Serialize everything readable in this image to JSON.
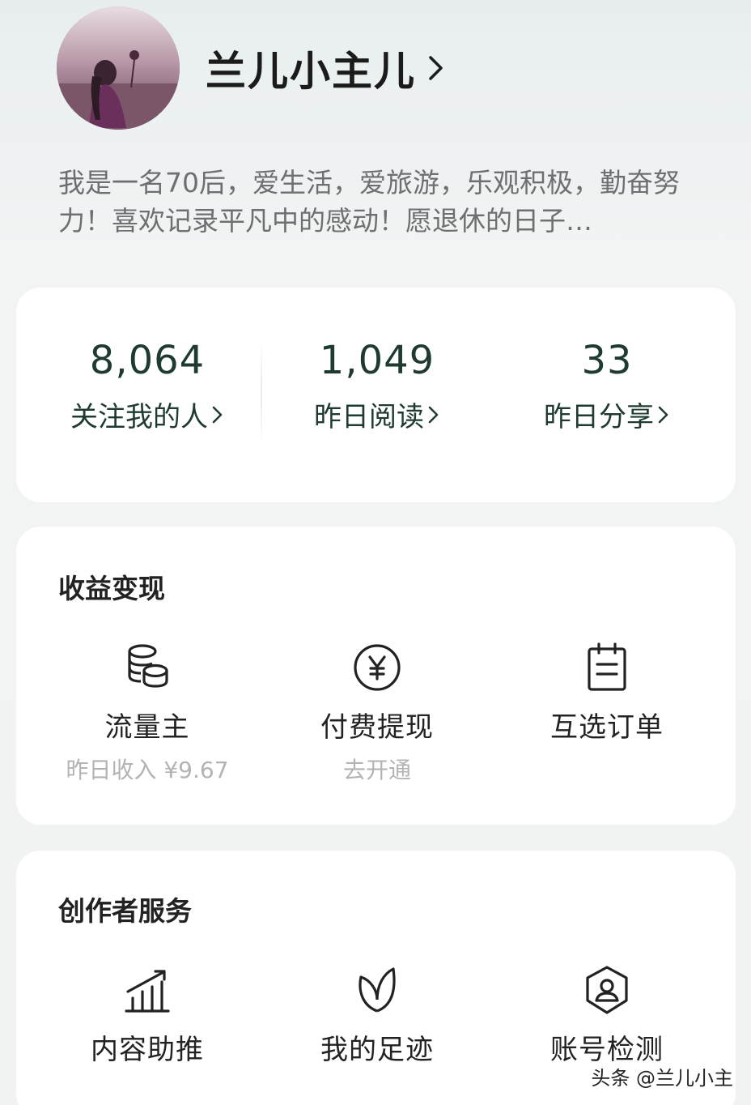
{
  "profile": {
    "username": "兰儿小主儿",
    "bio": "我是一名70后，爱生活，爱旅游，乐观积极，勤奋努力！喜欢记录平凡中的感动！愿退休的日子…"
  },
  "stats": [
    {
      "value": "8,064",
      "label": "关注我的人"
    },
    {
      "value": "1,049",
      "label": "昨日阅读"
    },
    {
      "value": "33",
      "label": "昨日分享"
    }
  ],
  "income": {
    "title": "收益变现",
    "items": [
      {
        "icon": "coins-icon",
        "name": "流量主",
        "sub": "昨日收入 ¥9.67"
      },
      {
        "icon": "yuan-circle-icon",
        "name": "付费提现",
        "sub": "去开通"
      },
      {
        "icon": "order-clipboard-icon",
        "name": "互选订单",
        "sub": ""
      }
    ]
  },
  "creator": {
    "title": "创作者服务",
    "items": [
      {
        "icon": "growth-chart-icon",
        "name": "内容助推"
      },
      {
        "icon": "leaf-sprout-icon",
        "name": "我的足迹"
      },
      {
        "icon": "shield-user-icon",
        "name": "账号检测"
      }
    ]
  },
  "watermark": "头条 @兰儿小主",
  "colors": {
    "stat_text": "#1f3b2f",
    "bio_text": "#6d6f70",
    "sub_text": "#b3b3b3",
    "card_bg": "#ffffff",
    "page_bg": "#f1f3f3"
  }
}
